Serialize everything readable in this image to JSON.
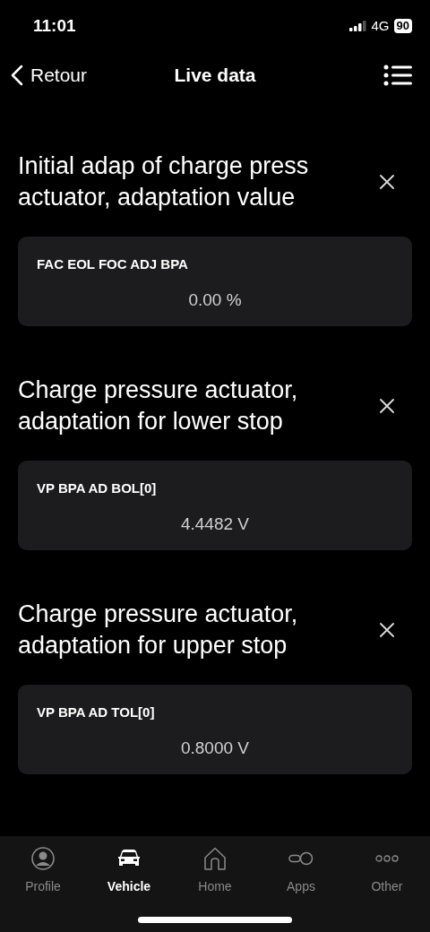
{
  "status_bar": {
    "time": "11:01",
    "network": "4G",
    "battery": "90"
  },
  "nav": {
    "back": "Retour",
    "title": "Live data"
  },
  "items": [
    {
      "title": "Initial adap of charge press actuator, adaptation value",
      "code": "FAC EOL FOC ADJ BPA",
      "value": "0.00 %"
    },
    {
      "title": "Charge pressure actuator, adaptation for lower stop",
      "code": "VP BPA AD BOL[0]",
      "value": "4.4482 V"
    },
    {
      "title": "Charge pressure actuator, adaptation for upper stop",
      "code": "VP BPA AD TOL[0]",
      "value": "0.8000 V"
    }
  ],
  "tabs": [
    {
      "label": "Profile",
      "selected": false
    },
    {
      "label": "Vehicle",
      "selected": true
    },
    {
      "label": "Home",
      "selected": false
    },
    {
      "label": "Apps",
      "selected": false
    },
    {
      "label": "Other",
      "selected": false
    }
  ]
}
